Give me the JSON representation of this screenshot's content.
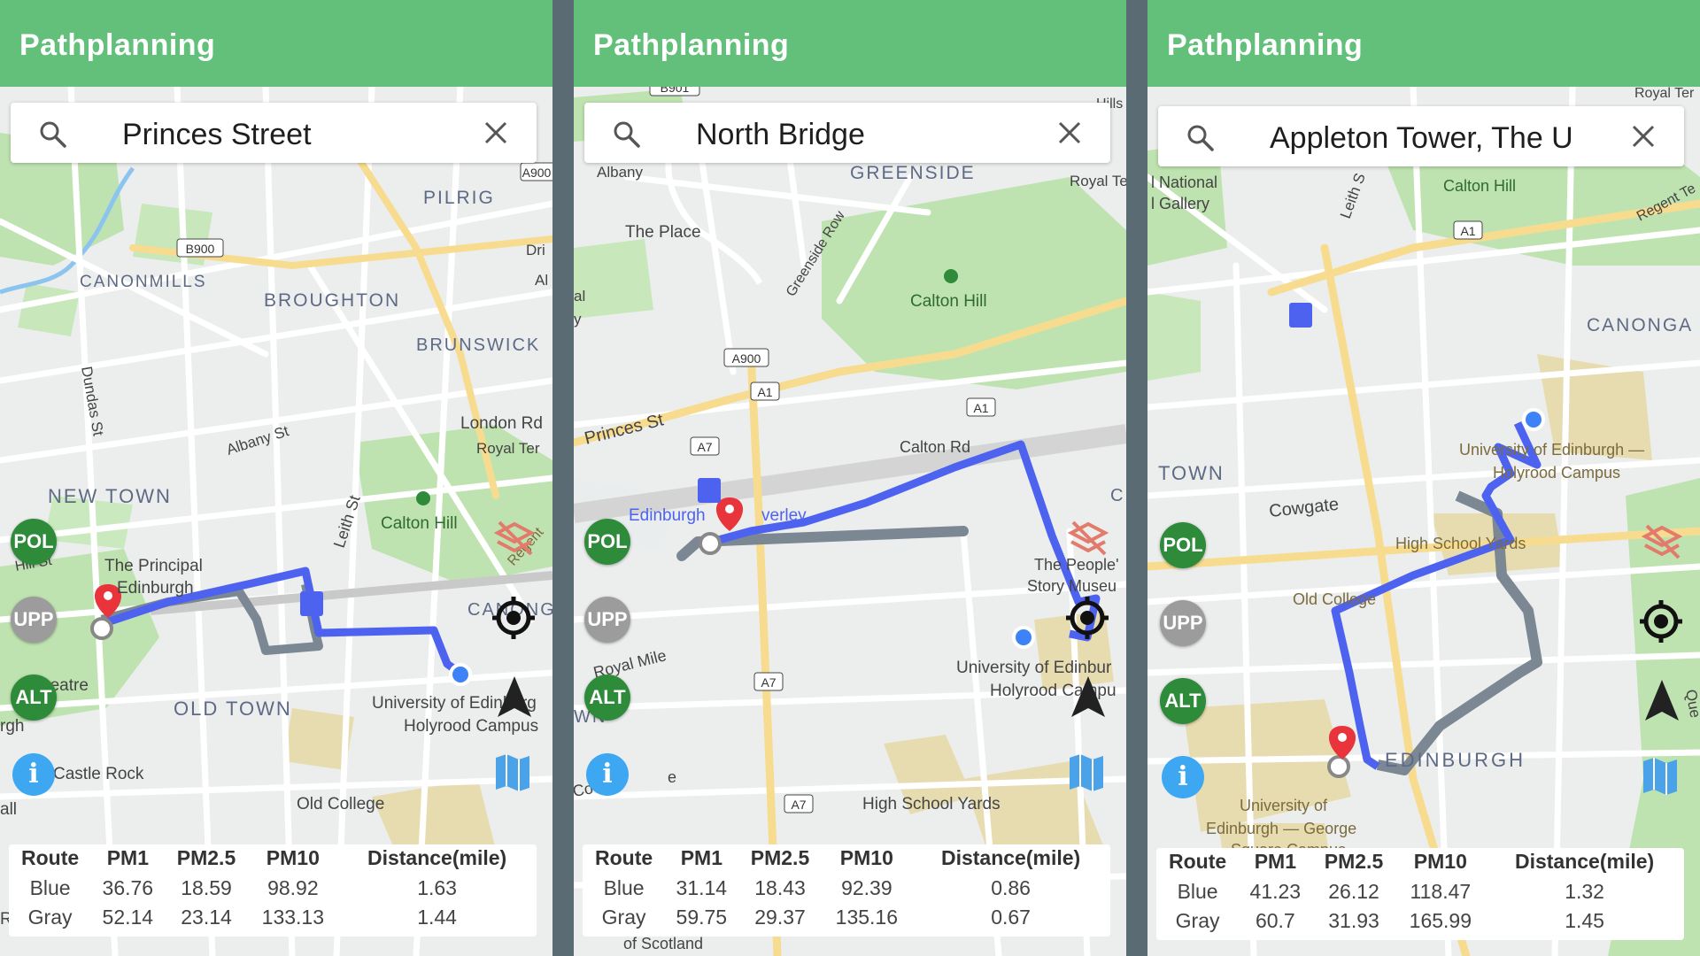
{
  "app": {
    "title": "Pathplanning"
  },
  "legend_colors": {
    "blue_route": "#4d63f0",
    "gray_route": "#7b8792",
    "appbar": "#63c07a",
    "pol": "#2e8b3a",
    "upp": "#9c9c9c",
    "alt": "#2e8b3a",
    "info": "#3da7f2"
  },
  "buttons": {
    "pol": "POL",
    "upp": "UPP",
    "alt": "ALT",
    "info": "i"
  },
  "table_headers": [
    "Route",
    "PM1",
    "PM2.5",
    "PM10",
    "Distance(mile)"
  ],
  "panels": [
    {
      "search": "Princes Street",
      "rows": [
        {
          "route": "Blue",
          "pm1": "36.76",
          "pm25": "18.59",
          "pm10": "98.92",
          "distance": "1.63"
        },
        {
          "route": "Gray",
          "pm1": "52.14",
          "pm25": "23.14",
          "pm10": "133.13",
          "distance": "1.44"
        }
      ],
      "map_labels": {
        "pilrig": "PILRIG",
        "b900": "B900",
        "a900": "A900",
        "canonmills": "CANONMILLS",
        "broughton": "BROUGHTON",
        "brunswick": "BRUNSWICK",
        "dundas": "Dundas St",
        "london_rd": "London Rd",
        "albany": "Albany St",
        "royal_ter": "Royal Ter",
        "new_town": "NEW TOWN",
        "leith": "Leith St",
        "calton_hill": "Calton Hill",
        "hill_st": "Hill St",
        "principal1": "The Principal",
        "principal2": "Edinburgh",
        "theatre": "s Theatre",
        "canong": "CANONG",
        "uni1": "University of Edinburg",
        "uni2": "Holyrood Campus",
        "old_town": "OLD TOWN",
        "castle_rock": "Castle Rock",
        "old_college": "Old College",
        "rgh": "rgh",
        "all": "all",
        "dri": "Dri",
        "al": "Al",
        "regent": "Regent",
        "r": "R"
      }
    },
    {
      "search": "North Bridge",
      "rows": [
        {
          "route": "Blue",
          "pm1": "31.14",
          "pm25": "18.43",
          "pm10": "92.39",
          "distance": "0.86"
        },
        {
          "route": "Gray",
          "pm1": "59.75",
          "pm25": "29.37",
          "pm10": "135.16",
          "distance": "0.67"
        }
      ],
      "map_labels": {
        "b901": "B901",
        "hills": "Hills",
        "albany": "Albany",
        "greenside": "GREENSIDE",
        "royal_te": "Royal Te",
        "the_place": "The Place",
        "greenside_row": "Greenside Row",
        "calton_hill": "Calton Hill",
        "al": "al",
        "y": "y",
        "a900": "A900",
        "a1a": "A1",
        "a1b": "A1",
        "princes": "Princes St",
        "a7a": "A7",
        "calton_rd": "Calton Rd",
        "waverley1": "Edinburgh",
        "waverley2": "verley",
        "c": "C",
        "peoples1": "The People'",
        "peoples2": "Story Museu",
        "royal_mile": "Royal Mile",
        "wn": "WN",
        "a7b": "A7",
        "uni1": "University of Edinbur",
        "uni2": "Holyrood Campu",
        "cowgate": "Cowg",
        "e": "e",
        "hsy": "High School Yards",
        "a7c": "A7",
        "of_scotland": "of Scotland"
      }
    },
    {
      "search": "Appleton Tower, The U",
      "rows": [
        {
          "route": "Blue",
          "pm1": "41.23",
          "pm25": "26.12",
          "pm10": "118.47",
          "distance": "1.32"
        },
        {
          "route": "Gray",
          "pm1": "60.7",
          "pm25": "31.93",
          "pm10": "165.99",
          "distance": "1.45"
        }
      ],
      "map_labels": {
        "royal_ter": "Royal Ter",
        "national1": "l National",
        "national2": "l Gallery",
        "leith": "Leith S",
        "calton_hill": "Calton Hill",
        "a1": "A1",
        "regent": "Regent Te",
        "canonga": "CANONGA",
        "town": "TOWN",
        "uni1": "University of Edinburgh —",
        "uni2": "Holyrood Campus",
        "cowgate": "Cowgate",
        "hsy": "High School Yards",
        "old_college": "Old College",
        "edinburgh": "EDINBURGH",
        "george1": "University of",
        "george2": "Edinburgh — George",
        "george3": "Square Campus",
        "que": "Que"
      }
    }
  ]
}
